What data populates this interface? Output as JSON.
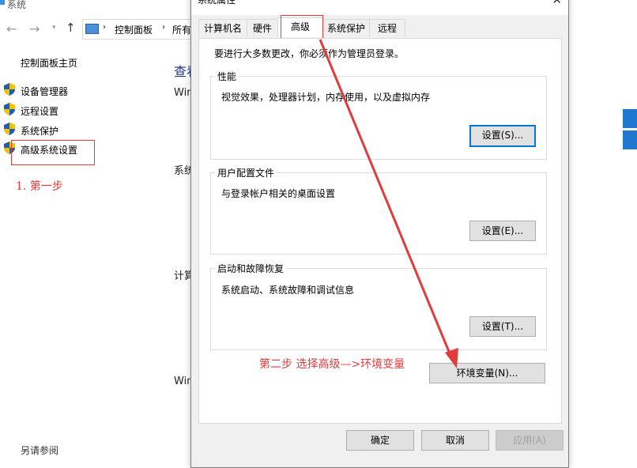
{
  "background": {
    "window_title": "系统",
    "breadcrumb": [
      "控制面板",
      "所有"
    ],
    "sidebar_home": "控制面板主页",
    "sidebar_items": [
      "设备管理器",
      "远程设置",
      "系统保护",
      "高级系统设置"
    ],
    "see_also": "另请参阅",
    "main_fragments": [
      "查看",
      "Win",
      "系统",
      "计算",
      "Win"
    ]
  },
  "annotations": {
    "step1": "1. 第一步",
    "step2": "第二步  选择高级—>环境变量"
  },
  "dialog": {
    "title": "系统属性",
    "close_glyph": "✕",
    "tabs": [
      "计算机名",
      "硬件",
      "高级",
      "系统保护",
      "远程"
    ],
    "active_tab": "高级",
    "admin_note": "要进行大多数更改，你必须作为管理员登录。",
    "groups": [
      {
        "title": "性能",
        "desc": "视觉效果，处理器计划，内存使用，以及虚拟内存",
        "button": "设置(S)..."
      },
      {
        "title": "用户配置文件",
        "desc": "与登录帐户相关的桌面设置",
        "button": "设置(E)..."
      },
      {
        "title": "启动和故障恢复",
        "desc": "系统启动、系统故障和调试信息",
        "button": "设置(T)..."
      }
    ],
    "env_button": "环境变量(N)...",
    "footer": {
      "ok": "确定",
      "cancel": "取消",
      "apply": "应用(A)"
    }
  },
  "colors": {
    "annotation_red": "#e23b3b",
    "focus_blue": "#0078d7",
    "shield_blue": "#1e5fb4",
    "shield_yellow": "#f2c200"
  }
}
